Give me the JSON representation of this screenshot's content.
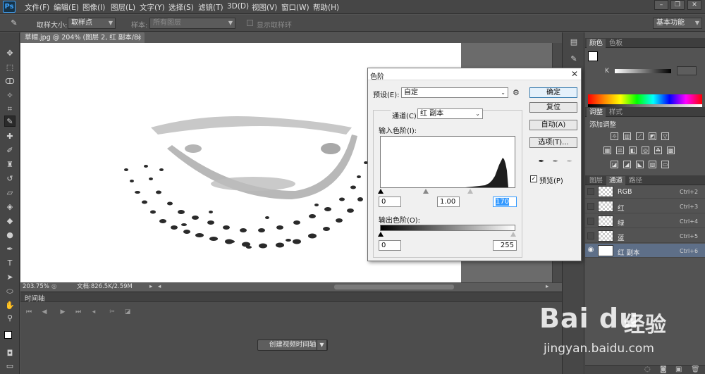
{
  "app": {
    "logo": "Ps"
  },
  "menu": [
    "文件(F)",
    "编辑(E)",
    "图像(I)",
    "图层(L)",
    "文字(Y)",
    "选择(S)",
    "滤镜(T)",
    "3D(D)",
    "视图(V)",
    "窗口(W)",
    "帮助(H)"
  ],
  "options": {
    "sample_size_label": "取样大小:",
    "sample_size_value": "取样点",
    "sample_label": "样本:",
    "sample_value": "所有图层",
    "show_ring_label": "显示取样环",
    "workspace": "基本功能"
  },
  "document": {
    "tab_title": "草帽.jpg @ 204% (图层 2, 红 副本/8) *",
    "zoom": "203.75%",
    "doc_info": "文档:826.5K/2.59M"
  },
  "timeline": {
    "title": "时间轴",
    "create_button": "创建视频时间轴"
  },
  "panels": {
    "color_tabs": [
      "颜色",
      "色板"
    ],
    "color_k_label": "K",
    "adjust_tabs": [
      "调整",
      "样式"
    ],
    "adjust_hint": "添加调整",
    "layer_tabs": [
      "图层",
      "通道",
      "路径"
    ],
    "channels": [
      {
        "name": "RGB",
        "key": "Ctrl+2",
        "visible": false
      },
      {
        "name": "红",
        "key": "Ctrl+3",
        "visible": false
      },
      {
        "name": "绿",
        "key": "Ctrl+4",
        "visible": false
      },
      {
        "name": "蓝",
        "key": "Ctrl+5",
        "visible": false
      },
      {
        "name": "红 副本",
        "key": "Ctrl+6",
        "visible": true
      }
    ]
  },
  "levels": {
    "title": "色阶",
    "preset_label": "预设(E):",
    "preset_value": "自定",
    "channel_label": "通道(C):",
    "channel_value": "红 副本",
    "input_label": "输入色阶(I):",
    "input_black": "0",
    "input_gamma": "1.00",
    "input_white": "170",
    "output_label": "输出色阶(O):",
    "output_black": "0",
    "output_white": "255",
    "btn_ok": "确定",
    "btn_reset": "复位",
    "btn_auto": "自动(A)",
    "btn_options": "选项(T)...",
    "preview_label": "预览(P)",
    "preview_checked": true
  },
  "watermark": {
    "logo": "Bai du",
    "cn": "经验",
    "url": "jingyan.baidu.com"
  }
}
